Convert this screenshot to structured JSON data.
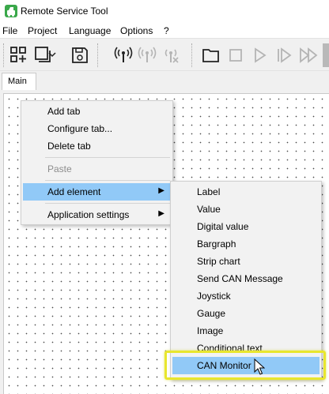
{
  "window": {
    "title": "Remote Service Tool",
    "icon": "app-logo-icon",
    "icon_color": "#3aa84a"
  },
  "menubar": {
    "items": [
      "File",
      "Project",
      "Language",
      "Options",
      "?"
    ]
  },
  "toolbar": {
    "buttons": [
      "add-widget-icon",
      "window-layout-icon",
      "save-icon",
      "connect-antenna-icon",
      "signal-disabled-icon",
      "signal-off-icon",
      "open-folder-icon",
      "stop-icon",
      "play-icon",
      "step-forward-icon",
      "fast-forward-icon"
    ]
  },
  "tabs": {
    "items": [
      "Main"
    ],
    "selected": "Main"
  },
  "context_menu": {
    "items": [
      {
        "label": "Add tab",
        "enabled": true
      },
      {
        "label": "Configure tab...",
        "enabled": true
      },
      {
        "label": "Delete tab",
        "enabled": true
      },
      {
        "label": "Paste",
        "enabled": false
      },
      {
        "label": "Add element",
        "enabled": true,
        "has_submenu": true,
        "selected": true
      },
      {
        "label": "Application settings",
        "enabled": true,
        "has_submenu": true
      }
    ],
    "submenu_arrow": "▶"
  },
  "submenu": {
    "items": [
      "Label",
      "Value",
      "Digital value",
      "Bargraph",
      "Strip chart",
      "Send CAN Message",
      "Joystick",
      "Gauge",
      "Image",
      "Conditional text",
      "CAN Monitor"
    ],
    "selected": "CAN Monitor",
    "highlight_color": "#e8e62e",
    "selection_color": "#91c9f7"
  }
}
